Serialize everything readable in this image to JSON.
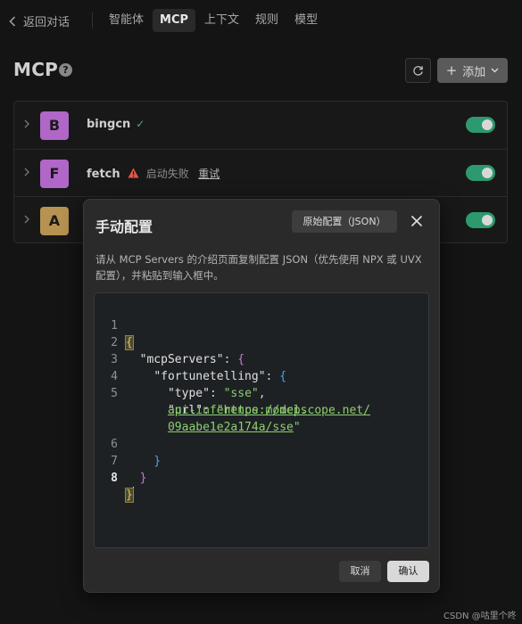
{
  "nav": {
    "back_label": "返回对话",
    "tabs": [
      {
        "label": "智能体",
        "active": false
      },
      {
        "label": "MCP",
        "active": true
      },
      {
        "label": "上下文",
        "active": false
      },
      {
        "label": "规则",
        "active": false
      },
      {
        "label": "模型",
        "active": false
      }
    ]
  },
  "page": {
    "title": "MCP",
    "help_glyph": "?",
    "add_label": "添加"
  },
  "servers": [
    {
      "letter": "B",
      "name": "bingcn",
      "status": "ok",
      "avatar_color": "#b067c8",
      "enabled": true
    },
    {
      "letter": "F",
      "name": "fetch",
      "status": "failed",
      "status_text": "启动失败",
      "retry_label": "重试",
      "avatar_color": "#b067c8",
      "enabled": true
    },
    {
      "letter": "A",
      "name": "",
      "status": "",
      "avatar_color": "#b69351",
      "enabled": true
    }
  ],
  "modal": {
    "title": "手动配置",
    "raw_button": "原始配置（JSON）",
    "description": "请从 MCP Servers 的介绍页面复制配置 JSON（优先使用 NPX 或 UVX 配置），并粘贴到输入框中。",
    "cancel_label": "取消",
    "ok_label": "确认",
    "code": {
      "line_numbers": [
        "1",
        "2",
        "3",
        "4",
        "5",
        "6",
        "7",
        "8"
      ],
      "key_mcp": "\"mcpServers\"",
      "key_fortune": "\"fortunetelling\"",
      "key_type": "\"type\"",
      "val_type": "\"sse\"",
      "key_url": "\"url\"",
      "url_part1": "https://mcp.",
      "url_part2": "api-inference.modelscope.net/",
      "url_part3": "09aabe1e2a174a/sse",
      "current_line": "8"
    }
  },
  "watermark": "CSDN @咕里个咚",
  "colors": {
    "accent_green": "#2c9a6e",
    "check_green": "#3fb27f",
    "warning_red": "#e0564a"
  }
}
